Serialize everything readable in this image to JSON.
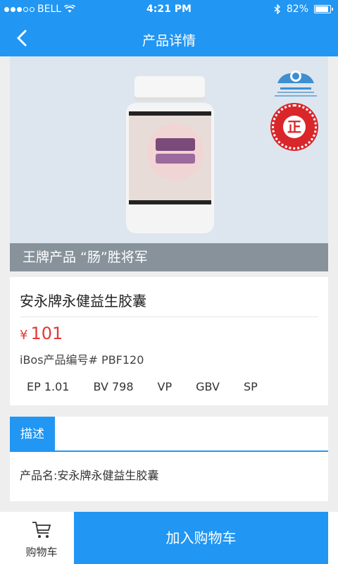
{
  "status_bar": {
    "carrier": "BELL",
    "time": "4:21 PM",
    "battery": "82%",
    "battery_level": 0.82
  },
  "nav": {
    "title": "产品详情"
  },
  "hero": {
    "banner_text": "王牌产品 “肠”胜将军",
    "seal_char": "正"
  },
  "product": {
    "name": "安永牌永健益生胶囊",
    "currency": "¥",
    "price": "101",
    "code": "iBos产品编号# PBF120",
    "stats": [
      "EP 1.01",
      "BV 798",
      "VP",
      "GBV",
      "SP"
    ]
  },
  "description": {
    "tab_label": "描述",
    "content": "产品名:安永牌永健益生胶囊"
  },
  "bottom": {
    "cart_label": "购物车",
    "add_label": "加入购物车"
  },
  "colors": {
    "primary": "#2196f3",
    "price": "#e53935"
  }
}
